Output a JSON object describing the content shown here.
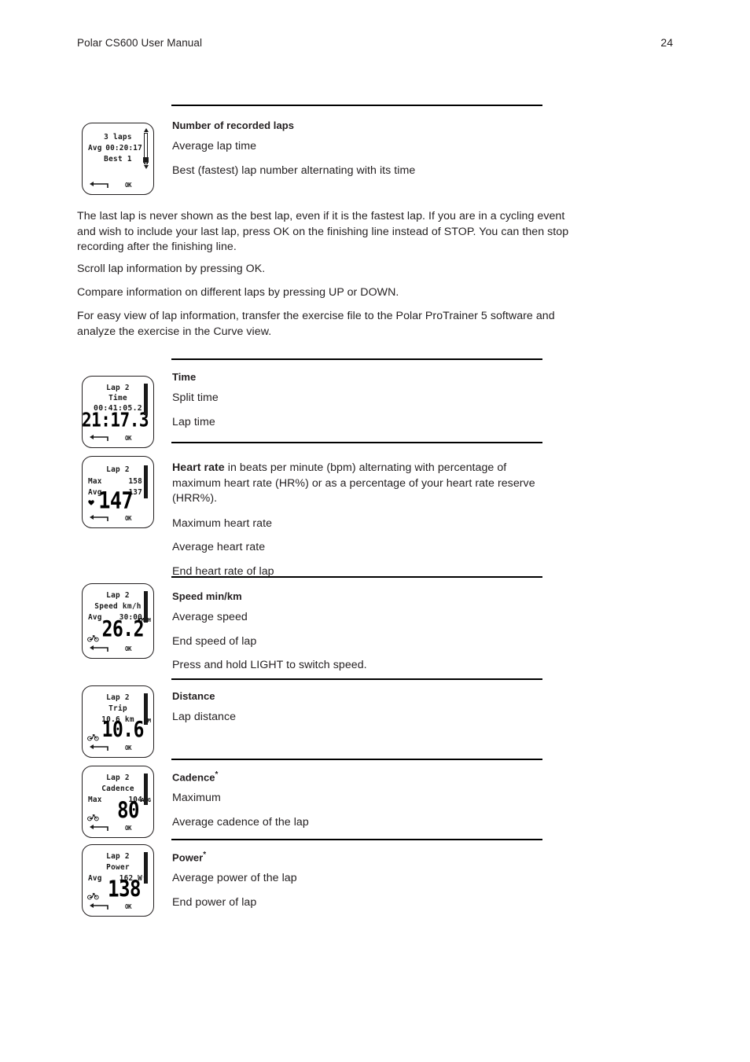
{
  "header": {
    "title": "Polar CS600 User Manual",
    "page_number": "24"
  },
  "paragraphs": {
    "p1": "The last lap is never shown as the best lap, even if it is the fastest lap. If you are in a cycling event and wish to include your last lap, press OK on the finishing line instead of STOP. You can then stop recording after the finishing line.",
    "p2": "Scroll lap information by pressing OK.",
    "p3": "Compare information on different laps by pressing UP or DOWN.",
    "p4": "For easy view of lap information, transfer the exercise file to the Polar ProTrainer 5 software and analyze the exercise in the Curve view."
  },
  "sections": {
    "laps": {
      "head": "Number of recorded laps",
      "line1": "Average lap time",
      "line2": "Best (fastest) lap number alternating with its time"
    },
    "time": {
      "head": "Time",
      "line1": "Split time",
      "line2": "Lap time"
    },
    "heartrate": {
      "head": "Heart rate",
      "head_rest": " in beats per minute (bpm) alternating with percentage of maximum heart rate (HR%) or as a percentage of your heart rate reserve (HRR%).",
      "line1": "Maximum heart rate",
      "line2": "Average heart rate",
      "line3": "End heart rate of lap"
    },
    "speed": {
      "head": "Speed min/km",
      "line1": "Average speed",
      "line2": "End speed of lap",
      "line3": "Press and hold LIGHT to switch speed."
    },
    "distance": {
      "head": "Distance",
      "line1": "Lap distance"
    },
    "cadence": {
      "head": "Cadence",
      "star": "*",
      "line1": "Maximum",
      "line2": "Average cadence of the lap"
    },
    "power": {
      "head": "Power",
      "star": "*",
      "line1": "Average power of the lap",
      "line2": "End power of lap"
    }
  },
  "devices": {
    "laps": {
      "line1": "3 laps",
      "row_label": "Avg",
      "row_value": "00:20:17",
      "line3": "Best 1",
      "ok_label": "OK"
    },
    "time": {
      "line1": "Lap 2",
      "line2": "Time",
      "line3": "00:41:05.2",
      "big": "21:17.3",
      "ok_label": "OK"
    },
    "heartrate": {
      "line1": "Lap 2",
      "row1_label": "Max",
      "row1_value": "158",
      "row2_label": "Avg",
      "row2_value": "137",
      "big": "147",
      "ok_label": "OK"
    },
    "speed": {
      "line1": "Lap 2",
      "line2": "Speed km/h",
      "row_label": "Avg",
      "row_value": "30:00",
      "big": "26.2",
      "unit": "KM/H",
      "ok_label": "OK"
    },
    "distance": {
      "line1": "Lap 2",
      "line2": "Trip",
      "line3": "10.6 km",
      "big": "10.6",
      "unit": "KM",
      "ok_label": "OK"
    },
    "cadence": {
      "line1": "Lap 2",
      "line2": "Cadence",
      "row_label": "Max",
      "row_value": "104",
      "big": "80",
      "unit": "AVG",
      "ok_label": "OK"
    },
    "power": {
      "line1": "Lap 2",
      "line2": "Power",
      "row_label": "Avg",
      "row_value": "162 W",
      "big": "138",
      "unit": "W",
      "ok_label": "OK"
    }
  }
}
